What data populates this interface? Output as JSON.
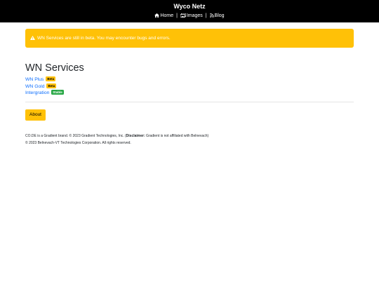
{
  "header": {
    "brand": "Wyco Netz",
    "nav": [
      {
        "label": "Home",
        "icon": "home-icon"
      },
      {
        "label": "Images",
        "icon": "images-icon"
      },
      {
        "label": "Blog",
        "icon": "rss-icon"
      }
    ],
    "separator": "|"
  },
  "alert": {
    "text": "WN Services are still in beta. You may encounter bugs and errors.",
    "icon": "warning-icon",
    "color": "#ffc107"
  },
  "main": {
    "title": "WN Services",
    "services": [
      {
        "label": "WN Plus",
        "badge": "Beta",
        "badge_color": "#ffc107"
      },
      {
        "label": "WN Gold",
        "badge": "Beta",
        "badge_color": "#ffc107"
      },
      {
        "label": "Intergration",
        "badge": "Stable",
        "badge_color": "#28a745"
      }
    ],
    "about_button": "About"
  },
  "footer": {
    "line1_pre": "CO.DE is a Gradient brand. © 2023 Gradient Technologies, Inc. (",
    "line1_bold": "Disclaimer:",
    "line1_post": " Gradient is not affiliated with Belnevach)",
    "line2": "© 2023 Belnevach-VT Technologies Corporation. All rights reserved."
  }
}
